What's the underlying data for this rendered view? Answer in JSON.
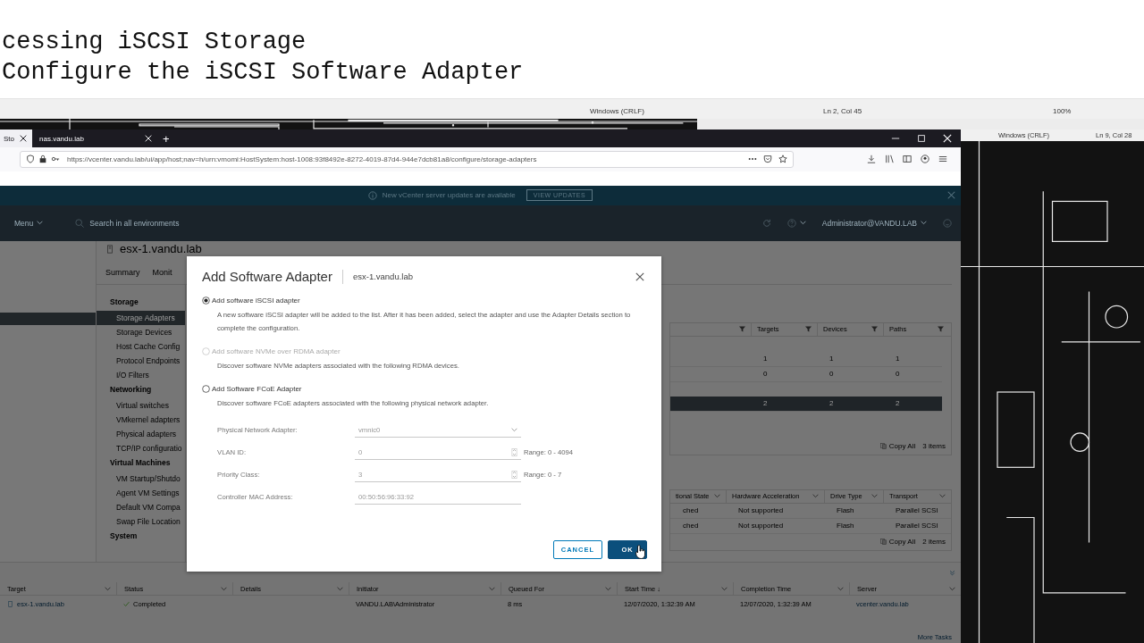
{
  "editor": {
    "lines": [
      "cessing iSCSI Storage",
      "Configure the iSCSI Software Adapter"
    ],
    "status": [
      "Windows (CRLF)",
      "Ln 2, Col 45",
      "100%"
    ]
  },
  "side_editor": {
    "status": [
      "Windows (CRLF)",
      "Ln 9, Col 28"
    ]
  },
  "browser": {
    "tabs": [
      {
        "label": "Sto",
        "selected": true
      },
      {
        "label": "nas.vandu.lab",
        "selected": false
      }
    ],
    "new_tab": "+",
    "url": "https://vcenter.vandu.lab/ui/app/host;nav=h/urn:vmomi:HostSystem:host-1008:93f8492e-8272-4019-87d4-944e7dcb81a8/configure/storage-adapters"
  },
  "banner": {
    "message": "New vCenter server updates are available",
    "button": "VIEW UPDATES"
  },
  "header": {
    "menu": "Menu",
    "search_placeholder": "Search in all environments",
    "user": "Administrator@VANDU.LAB"
  },
  "host": {
    "title": "esx-1.vandu.lab",
    "tabs": [
      {
        "label": "Summary",
        "selected": false
      },
      {
        "label": "Monit",
        "selected": false
      }
    ]
  },
  "config_nav": [
    {
      "label": "Storage",
      "items": [
        {
          "label": "Storage Adapters",
          "selected": true
        },
        {
          "label": "Storage Devices",
          "selected": false
        },
        {
          "label": "Host Cache Config",
          "selected": false
        },
        {
          "label": "Protocol Endpoints",
          "selected": false
        },
        {
          "label": "I/O Filters",
          "selected": false
        }
      ]
    },
    {
      "label": "Networking",
      "items": [
        {
          "label": "Virtual switches",
          "selected": false
        },
        {
          "label": "VMkernel adapters",
          "selected": false
        },
        {
          "label": "Physical adapters",
          "selected": false
        },
        {
          "label": "TCP/IP configuratio",
          "selected": false
        }
      ]
    },
    {
      "label": "Virtual Machines",
      "items": [
        {
          "label": "VM Startup/Shutdo",
          "selected": false
        },
        {
          "label": "Agent VM Settings",
          "selected": false
        },
        {
          "label": "Default VM Compa",
          "selected": false
        },
        {
          "label": "Swap File Location",
          "selected": false
        }
      ]
    },
    {
      "label": "System"
    }
  ],
  "adapters_table": {
    "columns": [
      "Targets",
      "Devices",
      "Paths"
    ],
    "rows": [
      {
        "cells": [
          "1",
          "1",
          "1"
        ],
        "selected": false
      },
      {
        "cells": [
          "0",
          "0",
          "0"
        ],
        "selected": false
      },
      {
        "cells": [
          "2",
          "2",
          "2"
        ],
        "selected": true
      }
    ],
    "copy": "Copy All",
    "count": "3 items"
  },
  "devices_table": {
    "columns": [
      "tional State",
      "Hardware Acceleration",
      "Drive Type",
      "Transport"
    ],
    "rows": [
      [
        "ched",
        "Not supported",
        "Flash",
        "Parallel SCSI"
      ],
      [
        "ched",
        "Not supported",
        "Flash",
        "Parallel SCSI"
      ]
    ],
    "copy": "Copy All",
    "count": "2 items"
  },
  "tasks": {
    "columns": [
      "Target",
      "Status",
      "Details",
      "Initiator",
      "Queued For",
      "Start Time ↓",
      "Completion Time",
      "Server"
    ],
    "rows": [
      {
        "target": "esx-1.vandu.lab",
        "status": "Completed",
        "initiator": "VANDU.LAB\\Administrator",
        "queued": "8 ms",
        "start": "12/07/2020, 1:32:39 AM",
        "completion": "12/07/2020, 1:32:39 AM",
        "server": "vcenter.vandu.lab"
      }
    ],
    "more": "More Tasks"
  },
  "dialog": {
    "title": "Add Software Adapter",
    "subtitle": "esx-1.vandu.lab",
    "options": [
      {
        "label": "Add software iSCSI adapter",
        "description": "A new software iSCSI adapter will be added to the list. After it has been added, select the adapter and use the Adapter Details section to complete the configuration.",
        "selected": true,
        "disabled": false
      },
      {
        "label": "Add software NVMe over RDMA adapter",
        "description": "Discover software NVMe adapters associated with the following RDMA devices.",
        "selected": false,
        "disabled": true
      },
      {
        "label": "Add Software FCoE Adapter",
        "description": "Discover software FCoE adapters associated with the following physical network adapter.",
        "selected": false,
        "disabled": false
      }
    ],
    "fields": [
      {
        "kind": "select",
        "label": "Physical Network Adapter:",
        "value": "vmnic0"
      },
      {
        "kind": "number",
        "label": "VLAN ID:",
        "value": "0",
        "hint": "Range: 0 - 4094"
      },
      {
        "kind": "number",
        "label": "Priority Class:",
        "value": "3",
        "hint": "Range: 0 - 7"
      },
      {
        "kind": "text",
        "label": "Controller MAC Address:",
        "value": "00:50:56:96:33:92"
      }
    ],
    "cancel": "CANCEL",
    "ok": "OK"
  }
}
